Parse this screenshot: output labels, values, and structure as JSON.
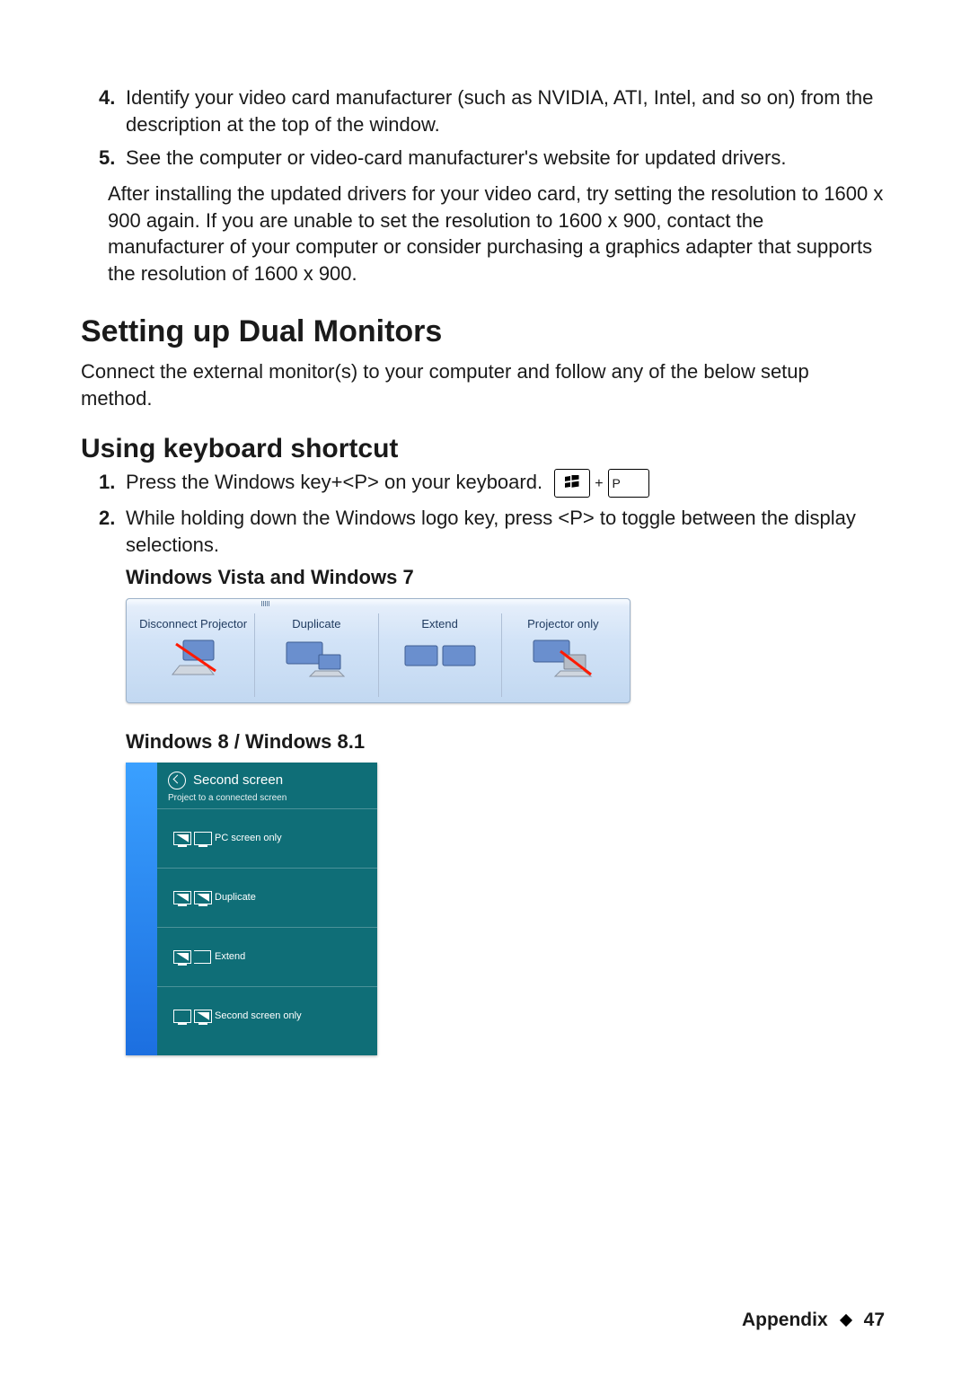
{
  "steps_cont": [
    {
      "n": "4.",
      "text": "Identify your video card manufacturer (such as NVIDIA, ATI, Intel, and so on) from the description at the top of the window."
    },
    {
      "n": "5.",
      "text": "See the computer or video-card manufacturer's website for updated drivers."
    }
  ],
  "after_para": "After installing the updated drivers for your video card, try setting the resolution to 1600 x 900 again. If you are unable to set the resolution to 1600 x 900, contact the manufacturer of your computer or consider purchasing a graphics adapter that supports the resolution of 1600 x 900.",
  "h1_dual": "Setting up Dual Monitors",
  "dual_para": "Connect the external monitor(s) to your computer and follow any of the below setup method.",
  "h2_kb": "Using keyboard shortcut",
  "kb_steps": [
    {
      "n": "1.",
      "text": "Press the Windows key+<P> on your keyboard."
    },
    {
      "n": "2.",
      "text": "While holding down the Windows logo key, press <P> to toggle between the display selections."
    }
  ],
  "key_p": "P",
  "sub_vista7": "Windows Vista and Windows 7",
  "win7_options": [
    "Disconnect Projector",
    "Duplicate",
    "Extend",
    "Projector only"
  ],
  "sub_win8": "Windows 8 / Windows 8.1",
  "win8": {
    "title": "Second screen",
    "subtitle": "Project to a connected screen",
    "items": [
      "PC screen only",
      "Duplicate",
      "Extend",
      "Second screen only"
    ]
  },
  "footer_label": "Appendix",
  "footer_page": "47"
}
